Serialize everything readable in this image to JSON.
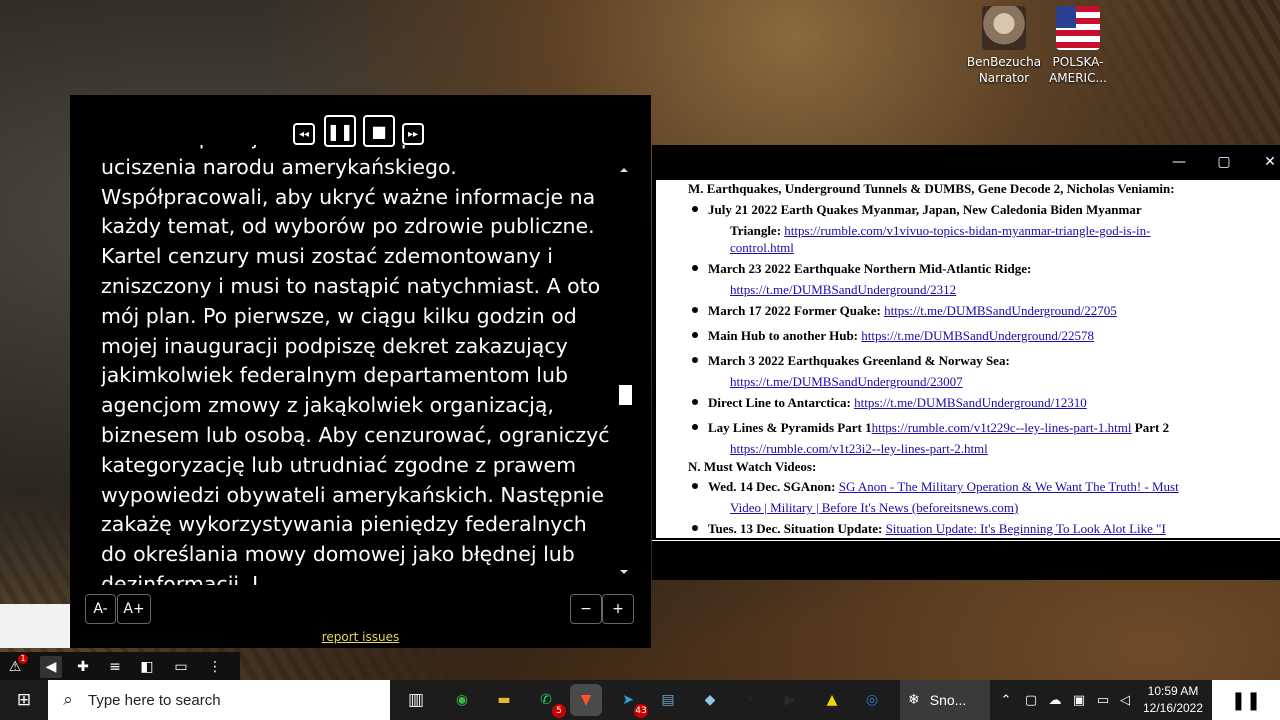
{
  "desktop": {
    "icons": [
      {
        "label_line1": "BenBezucha",
        "label_line2": "Narrator"
      },
      {
        "label_line1": "POLSKA-",
        "label_line2": "AMERIC..."
      }
    ]
  },
  "reader": {
    "controls": {
      "rewind": "◂◂",
      "pause": "❚❚",
      "stop": "■",
      "forward": "▸▸"
    },
    "text": "mediów spiskuje w celu manipulowania i uciszenia narodu amerykańskiego. Współpracowali, aby ukryć ważne informacje na każdy temat, od wyborów po zdrowie publiczne. Kartel cenzury musi zostać zdemontowany i zniszczony i musi to nastąpić natychmiast. A oto mój plan. Po pierwsze, w ciągu kilku godzin od mojej inauguracji podpiszę dekret zakazujący jakimkolwiek federalnym departamentom lub agencjom zmowy z jakąkolwiek organizacją, biznesem lub osobą. Aby cenzurować, ograniczyć kategoryzację lub utrudniać zgodne z prawem wypowiedzi obywateli amerykańskich. Następnie zakażę wykorzystywania pieniędzy federalnych do określania mowy domowej jako błędnej lub dezinformacji. I",
    "font_decrease": "A-",
    "font_increase": "A+",
    "speed_decrease": "−",
    "speed_increase": "+",
    "report_link": "report issues"
  },
  "docwindow": {
    "minimize": "—",
    "maximize": "▢",
    "close": "✕",
    "section_m": "M. Earthquakes, Underground Tunnels & DUMBS, Gene Decode 2, Nicholas Veniamin:",
    "items_m": [
      {
        "title": "July 21 2022 Earth Quakes Myanmar, Japan, New Caledonia Biden Myanmar",
        "title2": "Triangle:",
        "link": "https://rumble.com/v1vivuo-topics-bidan-myanmar-triangle-god-is-in-",
        "link2": "control.html"
      },
      {
        "title": "March 23 2022 Earthquake Northern Mid-Atlantic Ridge:",
        "link": "https://t.me/DUMBSandUnderground/2312"
      },
      {
        "title": "March 17 2022 Former Quake:",
        "link": "https://t.me/DUMBSandUnderground/22705"
      },
      {
        "title": "Main Hub to another Hub:",
        "link": "https://t.me/DUMBSandUnderground/22578"
      },
      {
        "title": "March 3 2022 Earthquakes Greenland & Norway Sea:",
        "link": "https://t.me/DUMBSandUnderground/23007"
      },
      {
        "title": "Direct Line to Antarctica:",
        "link": "https://t.me/DUMBSandUnderground/12310"
      },
      {
        "title": "Lay Lines & Pyramids Part 1",
        "link": "https://rumble.com/v1t229c--ley-lines-part-1.html",
        "after": " Part 2",
        "link2": "https://rumble.com/v1t23i2--ley-lines-part-2.html"
      }
    ],
    "section_n": "N. Must Watch Videos:",
    "items_n": [
      {
        "title": "Wed. 14 Dec. SGAnon:",
        "link": "SG Anon - The Military Operation & We Want The Truth! - Must",
        "link2": "Video | Military | Before It's News (beforeitsnews.com)"
      },
      {
        "title": "Tues. 13 Dec. Situation Update:",
        "link": "Situation Update: It's Beginning To Look Alot Like \"I"
      }
    ]
  },
  "taskbar": {
    "search_placeholder": "Type here to search",
    "apps": [
      {
        "name": "android-app",
        "color": "#3ab54a",
        "glyph": "◉",
        "badge": ""
      },
      {
        "name": "file-explorer",
        "color": "#e8b730",
        "glyph": "▬",
        "badge": ""
      },
      {
        "name": "whatsapp",
        "color": "#25d366",
        "glyph": "✆",
        "badge": "5"
      },
      {
        "name": "brave",
        "color": "#fb542b",
        "glyph": "▼",
        "badge": ""
      },
      {
        "name": "telegram",
        "color": "#2aa3df",
        "glyph": "➤",
        "badge": "43"
      },
      {
        "name": "notepad",
        "color": "#6aa0c8",
        "glyph": "▤",
        "badge": ""
      },
      {
        "name": "notes",
        "color": "#8ec7e8",
        "glyph": "◆",
        "badge": ""
      },
      {
        "name": "sharex",
        "color": "#2a2a2a",
        "glyph": "⚡",
        "badge": ""
      },
      {
        "name": "video-editor",
        "color": "#2a2a2a",
        "glyph": "▶",
        "badge": ""
      },
      {
        "name": "norton",
        "color": "#f2d600",
        "glyph": "▲",
        "badge": ""
      },
      {
        "name": "chrome-like",
        "color": "#2a7ad6",
        "glyph": "◎",
        "badge": ""
      }
    ],
    "snow_label": "Sno...",
    "time": "10:59 AM",
    "date": "12/16/2022",
    "notif_glyph": "❚❚"
  },
  "tray": {
    "badge": "1"
  },
  "colors": {
    "link": "#1a0dab",
    "report_link": "#e8d65a"
  }
}
